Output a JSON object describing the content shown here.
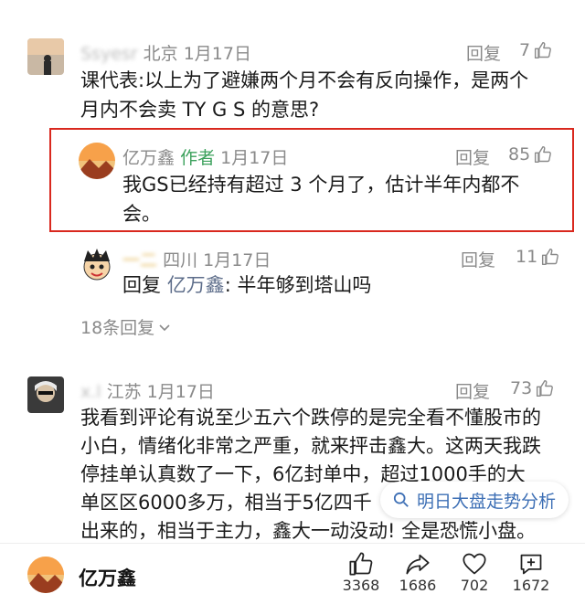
{
  "comments": [
    {
      "user_blur": "Ssyesr",
      "location": "北京",
      "date": "1月17日",
      "reply": "回复",
      "likes": "7",
      "line1": "课代表:以上为了避嫌两个月不会有反向操作，是两个",
      "line2": "月内不会卖 TY G S 的意思?"
    }
  ],
  "author_reply": {
    "name": "亿万鑫",
    "tag": "作者",
    "date": "1月17日",
    "reply": "回复",
    "likes": "85",
    "line1": "我GS已经持有超过 3 个月了，估计半年内都不",
    "line2": "会。"
  },
  "sub_reply": {
    "user_blur": "一二",
    "location": "四川",
    "date": "1月17日",
    "reply": "回复",
    "likes": "11",
    "prefix": "回复",
    "target": "亿万鑫",
    "text": ": 半年够到塔山吗"
  },
  "more_replies": "18条回复",
  "comment2": {
    "user_blur": "x.l",
    "location": "江苏",
    "date": "1月17日",
    "reply": "回复",
    "likes": "73",
    "lines": [
      "我看到评论有说至少五六个跌停的是完全看不懂股市的",
      "小白，情绪化非常之严重，就来抨击鑫大。这两天我跌",
      "停挂单认真数了一下，6亿封单中，超过1000手的大",
      "单区区6000多万，相当于5亿四千",
      "出来的，相当于主力，鑫大一动没动! 全是恐慌小盘。"
    ]
  },
  "suggestion": "明日大盘走势分析",
  "bottom": {
    "author": "亿万鑫",
    "like_count": "3368",
    "share_count": "1686",
    "fav_count": "702",
    "comment_count": "1672"
  },
  "colors": {
    "highlight": "#d9281e",
    "author_tag": "#3ca15c",
    "link": "#3d6fb5"
  }
}
